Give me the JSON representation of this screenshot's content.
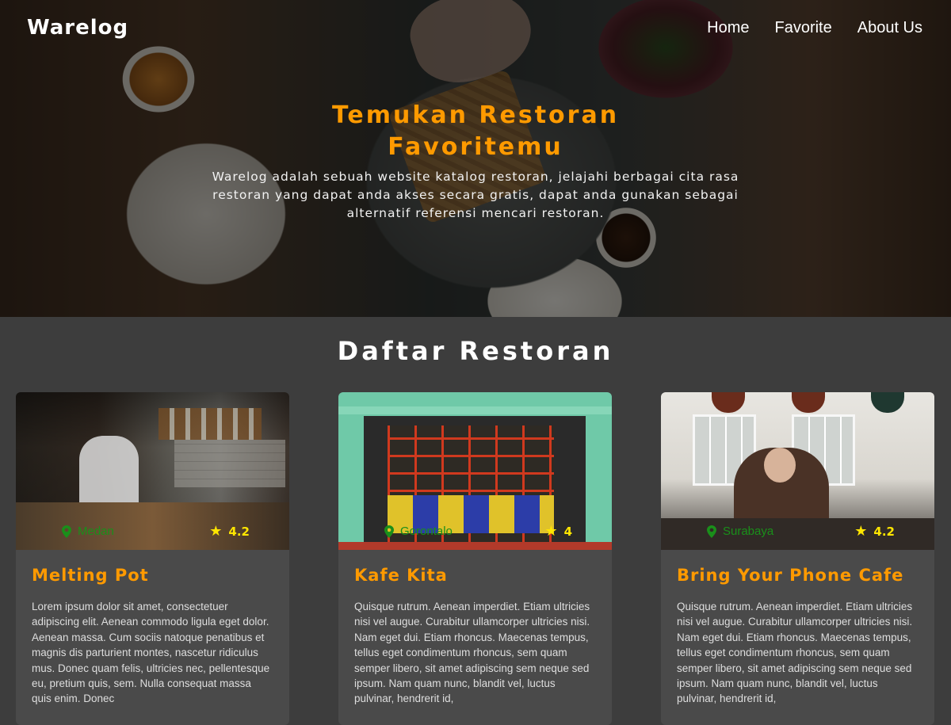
{
  "app": {
    "brand": "Warelog",
    "nav": [
      {
        "label": "Home"
      },
      {
        "label": "Favorite"
      },
      {
        "label": "About Us"
      }
    ]
  },
  "hero": {
    "title": "Temukan Restoran Favoritemu",
    "description": "Warelog adalah sebuah website katalog restoran, jelajahi berbagai cita rasa restoran yang dapat anda akses secara gratis, dapat anda gunakan sebagai alternatif referensi mencari restoran."
  },
  "main": {
    "section_title": "Daftar Restoran",
    "restaurants": [
      {
        "name": "Melting Pot",
        "city": "Medan",
        "rating": "4.2",
        "description": "Lorem ipsum dolor sit amet, consectetuer adipiscing elit. Aenean commodo ligula eget dolor. Aenean massa. Cum sociis natoque penatibus et magnis dis parturient montes, nascetur ridiculus mus. Donec quam felis, ultricies nec, pellentesque eu, pretium quis, sem. Nulla consequat massa quis enim. Donec"
      },
      {
        "name": "Kafe Kita",
        "city": "Gorontalo",
        "rating": "4",
        "description": "Quisque rutrum. Aenean imperdiet. Etiam ultricies nisi vel augue. Curabitur ullamcorper ultricies nisi. Nam eget dui. Etiam rhoncus. Maecenas tempus, tellus eget condimentum rhoncus, sem quam semper libero, sit amet adipiscing sem neque sed ipsum. Nam quam nunc, blandit vel, luctus pulvinar, hendrerit id,"
      },
      {
        "name": "Bring Your Phone Cafe",
        "city": "Surabaya",
        "rating": "4.2",
        "description": "Quisque rutrum. Aenean imperdiet. Etiam ultricies nisi vel augue. Curabitur ullamcorper ultricies nisi. Nam eget dui. Etiam rhoncus. Maecenas tempus, tellus eget condimentum rhoncus, sem quam semper libero, sit amet adipiscing sem neque sed ipsum. Nam quam nunc, blandit vel, luctus pulvinar, hendrerit id,"
      }
    ]
  },
  "icons": {
    "location": "location-pin-icon",
    "rating": "star-icon"
  },
  "colors": {
    "accent": "#ff9a00",
    "city": "#1a8f1a",
    "rating": "#ffe600",
    "background": "#3d3d3d",
    "card": "#4a4a4a"
  }
}
